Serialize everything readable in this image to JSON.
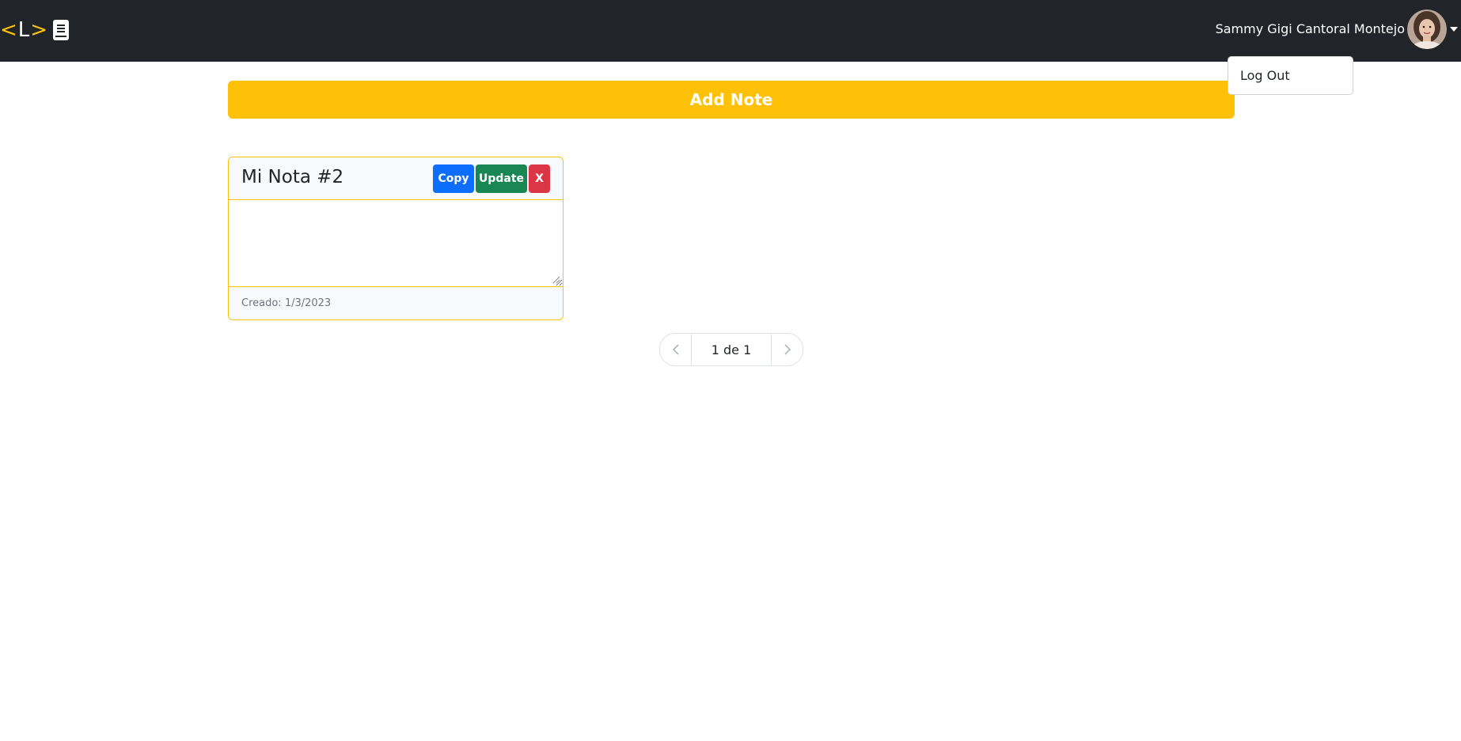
{
  "navbar": {
    "brand": {
      "open": "<",
      "letter": "L",
      "close": ">",
      "icon": "book-icon"
    },
    "user": {
      "name": "Sammy Gigi Cantoral Montejo",
      "avatar": "avatar-photo",
      "caret": "caret-down-icon"
    }
  },
  "dropdown": {
    "items": [
      {
        "label": "Log Out"
      }
    ]
  },
  "actions": {
    "add_note_label": "Add Note"
  },
  "notes": [
    {
      "title": "Mi Nota #2",
      "content": "",
      "copy_label": "Copy",
      "update_label": "Update",
      "delete_label": "X",
      "created": "Creado: 1/3/2023"
    }
  ],
  "pagination": {
    "label": "1 de 1",
    "prev_icon": "chevron-left-icon",
    "next_icon": "chevron-right-icon"
  },
  "colors": {
    "navbar": "#212529",
    "accent": "#ffc107",
    "copy": "#0d6efd",
    "update": "#198754",
    "delete": "#dc3545"
  }
}
